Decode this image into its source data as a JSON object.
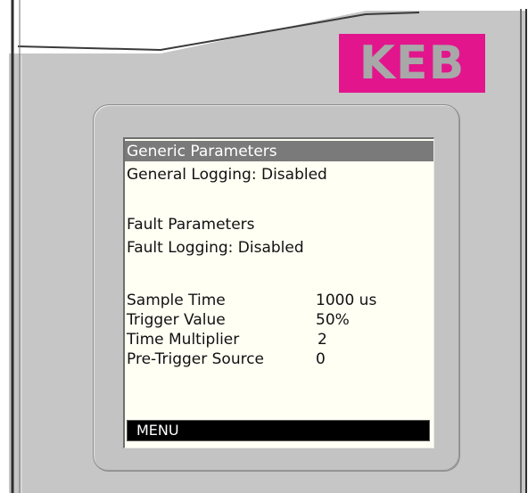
{
  "logo": {
    "text": "KEB"
  },
  "screen": {
    "header": "Generic Parameters",
    "general_logging": "General Logging: Disabled",
    "fault_parameters": "Fault Parameters",
    "fault_logging": "Fault Logging: Disabled",
    "rows": [
      {
        "label": "Sample Time",
        "value": "1000 us"
      },
      {
        "label": "Trigger Value",
        "value": "50%"
      },
      {
        "label": "Time Multiplier",
        "value": "2"
      },
      {
        "label": "Pre-Trigger Source",
        "value": "0"
      }
    ],
    "menu_label": "MENU"
  },
  "colors": {
    "brand_pink": "#e2158d",
    "device_gray": "#c6c6c6",
    "screen_bg": "#fffff4",
    "header_bar": "#7a7a7a"
  }
}
